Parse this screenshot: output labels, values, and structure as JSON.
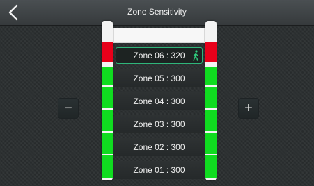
{
  "header": {
    "title": "Zone Sensitivity",
    "back_icon": "chevron-left-icon"
  },
  "controls": {
    "decrease_label": "−",
    "increase_label": "+"
  },
  "zones": [
    {
      "label": "Zone 06 : 320",
      "selected": true,
      "icon": "walking-person-icon"
    },
    {
      "label": "Zone 05 : 300",
      "selected": false
    },
    {
      "label": "Zone 04 : 300",
      "selected": false
    },
    {
      "label": "Zone 03 : 300",
      "selected": false
    },
    {
      "label": "Zone 02 : 300",
      "selected": false
    },
    {
      "label": "Zone 01 : 300",
      "selected": false
    }
  ],
  "colors": {
    "alarm_red": "#e8001a",
    "normal_green": "#10dc20",
    "selected_border": "#2fb57a",
    "empty_white": "#f3f3f3"
  }
}
